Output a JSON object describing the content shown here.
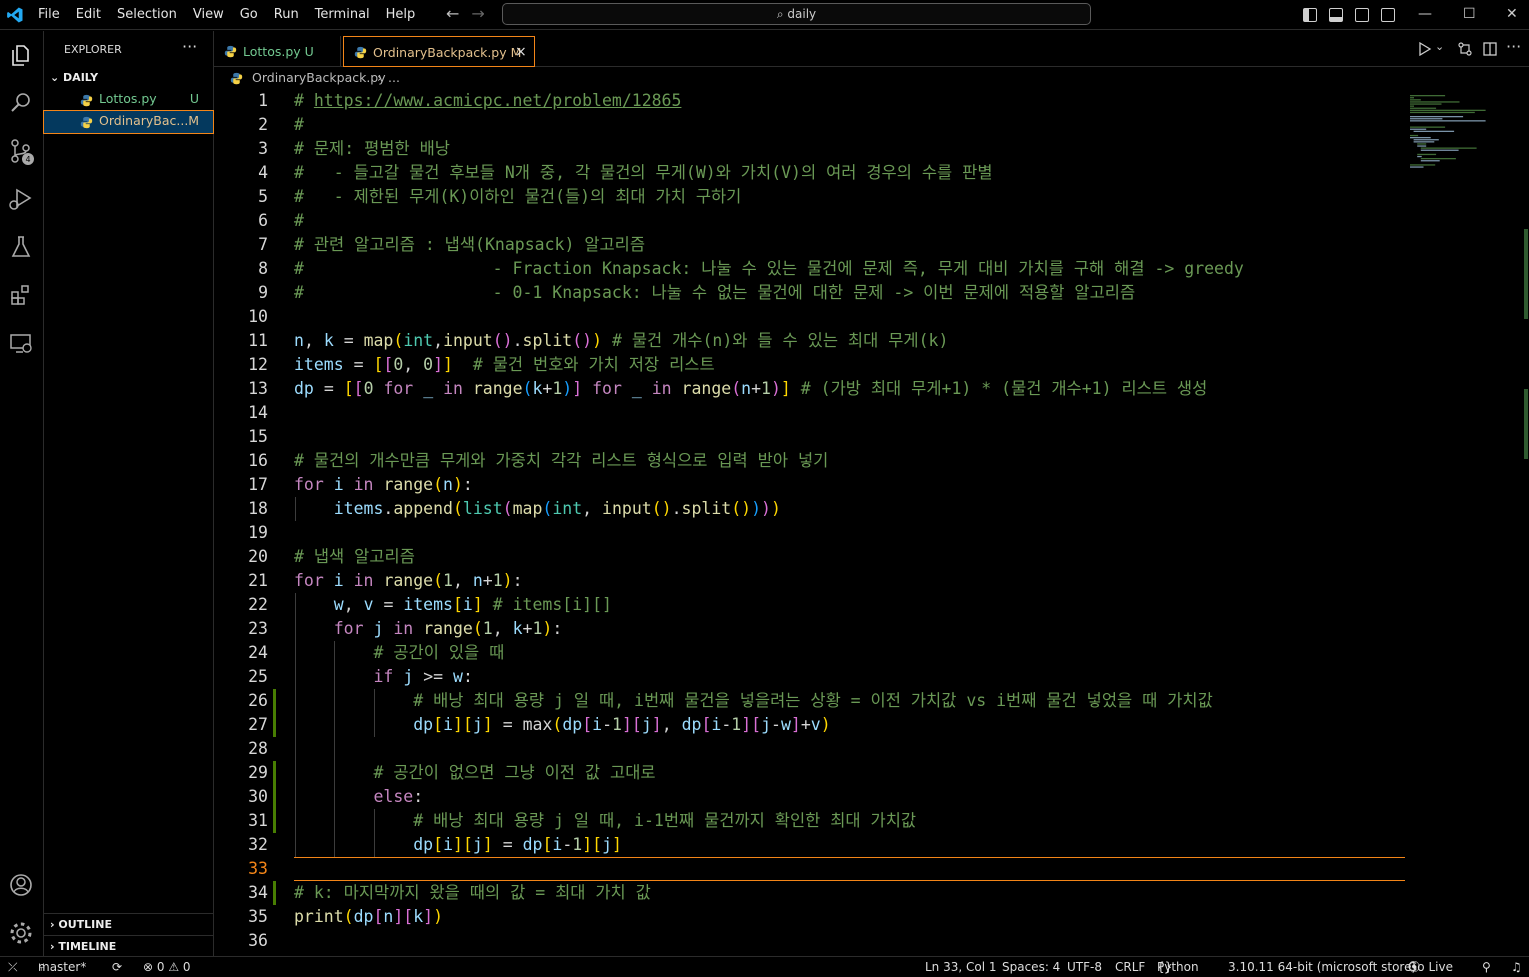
{
  "menu": [
    "File",
    "Edit",
    "Selection",
    "View",
    "Go",
    "Run",
    "Terminal",
    "Help"
  ],
  "search": "daily",
  "explorer": {
    "title": "EXPLORER",
    "folder": "DAILY",
    "files": [
      {
        "name": "Lottos.py",
        "badge": "U"
      },
      {
        "name": "OrdinaryBac...",
        "badge": "M"
      }
    ],
    "outline": "OUTLINE",
    "timeline": "TIMELINE"
  },
  "tabs": [
    {
      "name": "Lottos.py",
      "badge": "U"
    },
    {
      "name": "OrdinaryBackpack.py",
      "badge": "M",
      "close": "×"
    }
  ],
  "breadcrumb": {
    "file": "OrdinaryBackpack.py",
    "rest": "..."
  },
  "code": [
    {
      "n": "1",
      "t": "# https://www.acmicpc.net/problem/12865"
    },
    {
      "n": "2",
      "t": "#"
    },
    {
      "n": "3",
      "t": "# 문제: 평범한 배낭"
    },
    {
      "n": "4",
      "t": "#   - 들고갈 물건 후보들 N개 중, 각 물건의 무게(W)와 가치(V)의 여러 경우의 수를 판별"
    },
    {
      "n": "5",
      "t": "#   - 제한된 무게(K)이하인 물건(들)의 최대 가치 구하기"
    },
    {
      "n": "6",
      "t": "#"
    },
    {
      "n": "7",
      "t": "# 관련 알고리즘 : 냅색(Knapsack) 알고리즘"
    },
    {
      "n": "8",
      "t": "#                   - Fraction Knapsack: 나눌 수 있는 물건에 문제 즉, 무게 대비 가치를 구해 해결 -> greedy"
    },
    {
      "n": "9",
      "t": "#                   - 0-1 Knapsack: 나눌 수 없는 물건에 대한 문제 -> 이번 문제에 적용할 알고리즘"
    },
    {
      "n": "10",
      "t": ""
    },
    {
      "n": "11",
      "t": "n, k = map(int,input().split()) # 물건 개수(n)와 들 수 있는 최대 무게(k)"
    },
    {
      "n": "12",
      "t": "items = [[0, 0]]  # 물건 번호와 가치 저장 리스트"
    },
    {
      "n": "13",
      "t": "dp = [[0 for _ in range(k+1)] for _ in range(n+1)] # (가방 최대 무게+1) * (물건 개수+1) 리스트 생성"
    },
    {
      "n": "14",
      "t": ""
    },
    {
      "n": "15",
      "t": ""
    },
    {
      "n": "16",
      "t": "# 물건의 개수만큼 무게와 가중치 각각 리스트 형식으로 입력 받아 넣기"
    },
    {
      "n": "17",
      "t": "for i in range(n):"
    },
    {
      "n": "18",
      "t": "    items.append(list(map(int, input().split())))"
    },
    {
      "n": "19",
      "t": ""
    },
    {
      "n": "20",
      "t": "# 냅색 알고리즘"
    },
    {
      "n": "21",
      "t": "for i in range(1, n+1):"
    },
    {
      "n": "22",
      "t": "    w, v = items[i] # items[i][]"
    },
    {
      "n": "23",
      "t": "    for j in range(1, k+1):"
    },
    {
      "n": "24",
      "t": "        # 공간이 있을 때"
    },
    {
      "n": "25",
      "t": "        if j >= w:"
    },
    {
      "n": "26",
      "t": "            # 배낭 최대 용량 j 일 때, i번째 물건을 넣을려는 상황 = 이전 가치값 vs i번째 물건 넣었을 때 가치값"
    },
    {
      "n": "27",
      "t": "            dp[i][j] = max(dp[i-1][j], dp[i-1][j-w]+v)"
    },
    {
      "n": "28",
      "t": ""
    },
    {
      "n": "29",
      "t": "        # 공간이 없으면 그냥 이전 값 고대로"
    },
    {
      "n": "30",
      "t": "        else:"
    },
    {
      "n": "31",
      "t": "            # 배낭 최대 용량 j 일 때, i-1번째 물건까지 확인한 최대 가치값"
    },
    {
      "n": "32",
      "t": "            dp[i][j] = dp[i-1][j]"
    },
    {
      "n": "33",
      "t": ""
    },
    {
      "n": "34",
      "t": "# k: 마지막까지 왔을 때의 값 = 최대 가치 값"
    },
    {
      "n": "35",
      "t": "print(dp[n][k])"
    },
    {
      "n": "36",
      "t": ""
    }
  ],
  "status": {
    "branch": "master*",
    "problems": "⊗ 0 ⚠ 0",
    "position": "Ln 33, Col 1",
    "spaces": "Spaces: 4",
    "encoding": "UTF-8",
    "eol": "CRLF",
    "language": "Python",
    "interpreter": "3.10.11 64-bit (microsoft store)",
    "golive": "Go Live"
  },
  "badges": {
    "scm": "4"
  },
  "colors": {
    "accent": "#f38518",
    "added": "#73c991",
    "modified": "#e2c08d",
    "comment": "#6a9955"
  }
}
